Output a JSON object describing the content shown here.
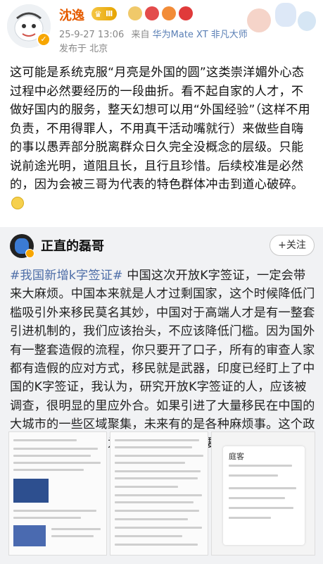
{
  "post": {
    "username": "沈逸",
    "level_badge": "Ⅲ",
    "timestamp": "25-9-27 13:06",
    "source_prefix": "来自",
    "device": "华为Mate XT 非凡大师",
    "location": "发布于 北京",
    "text": "这可能是系统克服“月亮是外国的圆”这类崇洋媚外心态过程中必然要经历的一段曲折。看不起自家的人才，不做好国内的服务，整天幻想可以用“外国经验”（这样不用负责，不用得罪人，不用真干活动嘴就行）来做些自嗨的事以愚弄部分脱离群众日久完全没概念的层级。只能说前途光明，道阻且长，且行且珍惜。后续校准是必然的，因为会被三哥为代表的特色群体冲击到道心破碎。"
  },
  "repost": {
    "username": "正直的磊哥",
    "follow_label": "+关注",
    "hashtag": "#我国新增k字签证#",
    "text": " 中国这次开放K字签证，一定会带来大麻烦。中国本来就是人才过剩国家，这个时候降低门槛吸引外来移民莫名其妙，中国对于高端人才是有一整套引进机制的，我们应该抬头，不应该降低门槛。因为国外有一整套造假的流程，你只要开了口子，所有的审查人家都有造假的应对方式，移民就是武器，印度已经盯上了中国的K字签证，我认为，研究开放K字签证的人，应该被调查，很明显的里应外合。如果引进了大量移民在中国的大城市的一些区域聚集，未来有的是各种麻烦事。这个政策谁制定通过的，为什么这么快，不要当历史的罪人",
    "thumb3_title": "庭客"
  },
  "icons": {
    "verified": "verified-badge-icon",
    "smile": "smile-emoji-icon"
  },
  "colors": {
    "username_vip": "#e65c00",
    "device_link": "#5a7fb5",
    "hashtag": "#4e6ea8",
    "repost_bg": "#f1f2f4"
  }
}
